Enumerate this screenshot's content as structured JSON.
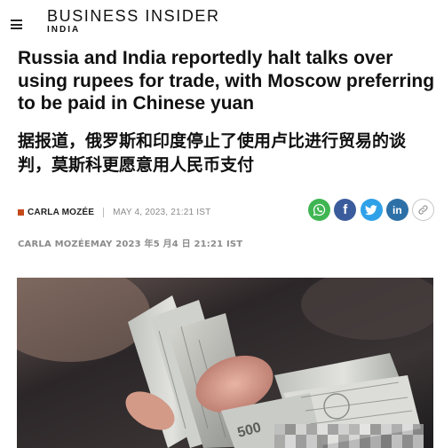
{
  "header": {
    "brand": "BUSINESS INSIDER",
    "edition": "INDIA",
    "menu_icon": "hamburger-menu-icon"
  },
  "article": {
    "title_en": "Russia and India reportedly halt talks over using rupees for trade, with Moscow preferring to be paid in Chinese yuan",
    "title_zh": "据报道，俄罗斯和印度停止了使用卢比进行贸易的谈判，莫斯科更愿意用人民币支付",
    "author": "CARLA MOZÉE",
    "date": "MAY 4, 2023, 21:21 IST",
    "byline_zh": "CARLA MOZÉEMAY 2023 年5 月4 日 21:21 IST",
    "author_color": "#c44a1a"
  },
  "share": {
    "whatsapp_icon": "whatsapp-icon",
    "facebook_glyph": "f",
    "twitter_icon": "twitter-icon",
    "linkedin_glyph": "in",
    "link_icon": "link-icon",
    "colors": {
      "whatsapp": "#3fb653",
      "facebook": "#3b5c9c",
      "twitter": "#2fa1e8",
      "linkedin": "#2d70a7"
    }
  },
  "image": {
    "banknote_text": "500"
  }
}
